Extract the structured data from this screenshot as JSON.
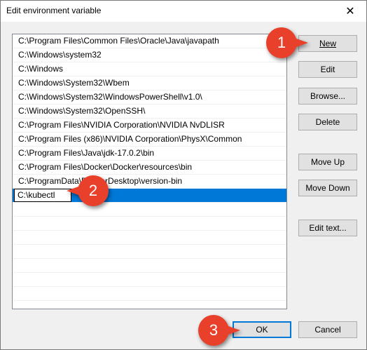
{
  "window": {
    "title": "Edit environment variable",
    "close_glyph": "✕"
  },
  "paths": [
    "C:\\Program Files\\Common Files\\Oracle\\Java\\javapath",
    "C:\\Windows\\system32",
    "C:\\Windows",
    "C:\\Windows\\System32\\Wbem",
    "C:\\Windows\\System32\\WindowsPowerShell\\v1.0\\",
    "C:\\Windows\\System32\\OpenSSH\\",
    "C:\\Program Files\\NVIDIA Corporation\\NVIDIA NvDLISR",
    "C:\\Program Files (x86)\\NVIDIA Corporation\\PhysX\\Common",
    "C:\\Program Files\\Java\\jdk-17.0.2\\bin",
    "C:\\Program Files\\Docker\\Docker\\resources\\bin",
    "C:\\ProgramData\\DockerDesktop\\version-bin"
  ],
  "edit_row": {
    "value": "C:\\kubectl"
  },
  "buttons": {
    "new": "New",
    "edit": "Edit",
    "browse": "Browse...",
    "delete": "Delete",
    "move_up": "Move Up",
    "move_down": "Move Down",
    "edit_text": "Edit text...",
    "ok": "OK",
    "cancel": "Cancel"
  },
  "callouts": {
    "one": "1",
    "two": "2",
    "three": "3",
    "color": "#e8402a"
  },
  "colors": {
    "selection": "#0078d7",
    "dialog_bg": "#f0f0f0",
    "button_bg": "#e1e1e1"
  }
}
